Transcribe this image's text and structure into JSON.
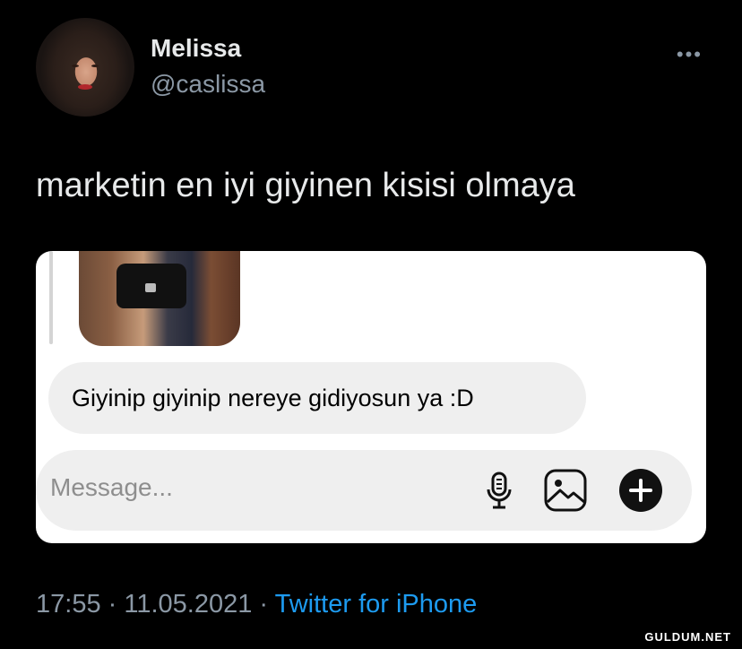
{
  "tweet": {
    "display_name": "Melissa",
    "handle": "@caslissa",
    "more_label": "•••",
    "text": "marketin en iyi giyinen kisisi olmaya"
  },
  "embedded_dm": {
    "message": "Giyinip giyinip nereye gidiyosun ya :D",
    "composer_placeholder": "Message...",
    "icons": [
      "microphone-icon",
      "gallery-icon",
      "plus-icon"
    ]
  },
  "meta": {
    "time": "17:55",
    "separator1": " · ",
    "date": "11.05.2021",
    "separator2": " · ",
    "source": "Twitter for iPhone"
  },
  "watermark": "GULDUM.NET",
  "colors": {
    "background": "#000000",
    "link": "#1d9bf0",
    "secondary_text": "#8b98a5"
  }
}
